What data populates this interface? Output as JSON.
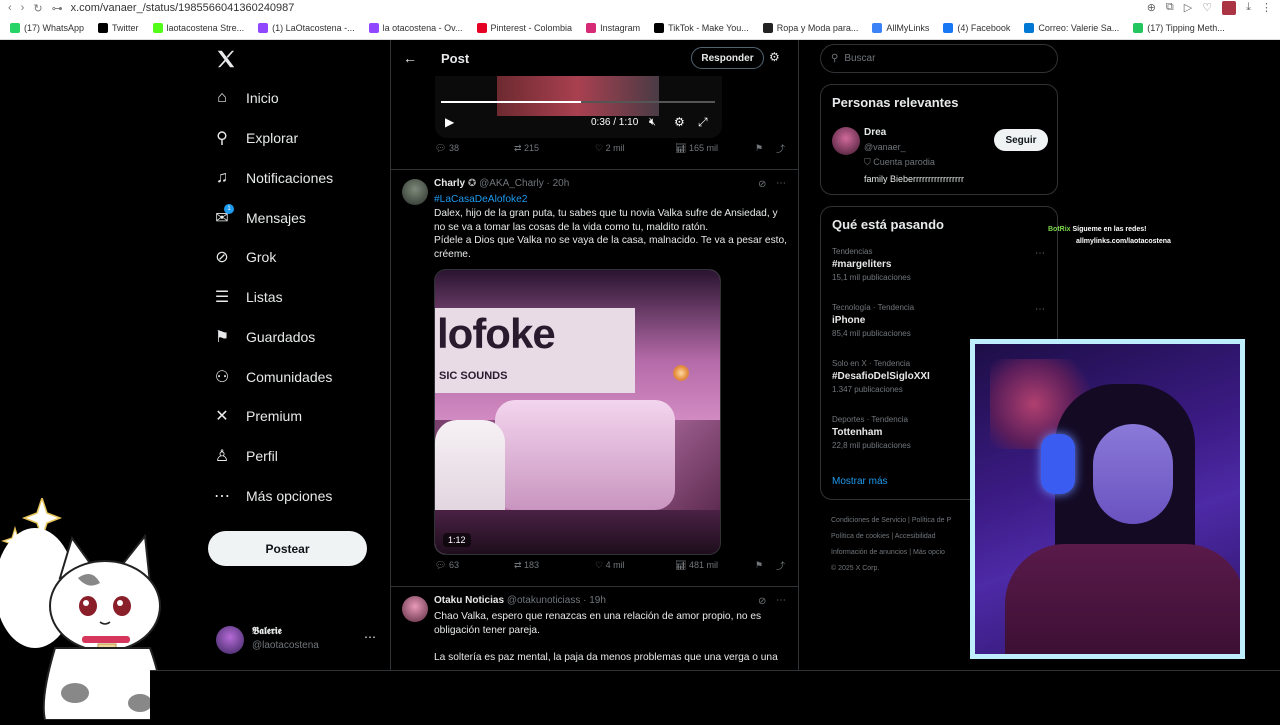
{
  "browser": {
    "url": "x.com/vanaer_/status/1985566041360240987",
    "bookmarks": [
      {
        "label": "(17) WhatsApp",
        "color": "#25d366"
      },
      {
        "label": "Twitter",
        "color": "#000000"
      },
      {
        "label": "laotacostena Stre...",
        "color": "#53fc18"
      },
      {
        "label": "(1) LaOtacostena -...",
        "color": "#9146ff"
      },
      {
        "label": "la otacostena - Ov...",
        "color": "#9146ff"
      },
      {
        "label": "Pinterest - Colombia",
        "color": "#e60023"
      },
      {
        "label": "Instagram",
        "color": "#d62976"
      },
      {
        "label": "TikTok - Make You...",
        "color": "#000000"
      },
      {
        "label": "Ropa y Moda para...",
        "color": "#222222"
      },
      {
        "label": "AllMyLinks",
        "color": "#3b82f6"
      },
      {
        "label": "(4) Facebook",
        "color": "#1877f2"
      },
      {
        "label": "Correo: Valerie Sa...",
        "color": "#0078d4"
      },
      {
        "label": "(17) Tipping Meth...",
        "color": "#22c55e"
      }
    ]
  },
  "sidebar": {
    "logo": "X",
    "items": [
      {
        "label": "Inicio",
        "icon": "home-icon",
        "glyph": "⌂"
      },
      {
        "label": "Explorar",
        "icon": "search-icon",
        "glyph": "⚲"
      },
      {
        "label": "Notificaciones",
        "icon": "bell-icon",
        "glyph": "♫"
      },
      {
        "label": "Mensajes",
        "icon": "mail-icon",
        "glyph": "✉"
      },
      {
        "label": "Grok",
        "icon": "grok-icon",
        "glyph": "⊘"
      },
      {
        "label": "Listas",
        "icon": "list-icon",
        "glyph": "☰"
      },
      {
        "label": "Guardados",
        "icon": "bookmark-icon",
        "glyph": "⚑"
      },
      {
        "label": "Comunidades",
        "icon": "people-icon",
        "glyph": "⚇"
      },
      {
        "label": "Premium",
        "icon": "x-premium-icon",
        "glyph": "✕"
      },
      {
        "label": "Perfil",
        "icon": "person-icon",
        "glyph": "♙"
      },
      {
        "label": "Más opciones",
        "icon": "more-circle-icon",
        "glyph": "⋯"
      }
    ],
    "messages_badge": "1",
    "post_button": "Postear",
    "account": {
      "name": "𝕭𝖆𝖑𝖊𝖗𝖎𝖊",
      "handle": "@laotacostena"
    }
  },
  "header": {
    "title": "Post",
    "reply_button": "Responder"
  },
  "video_top": {
    "time": "0:36 / 1:10",
    "progress": 0.51
  },
  "top_stats": {
    "replies": "38",
    "reposts": "215",
    "likes": "2 mil",
    "views": "165 mil"
  },
  "tweet1": {
    "name": "Charly",
    "handle": "@AKA_Charly · 20h",
    "hashtag": "#LaCasaDeAlofoke2",
    "line1": "Dalex, hijo de la gran puta, tu sabes que tu novia Valka sufre de Ansiedad, y no se va a tomar las cosas de la vida como tu, maldito ratón.",
    "line2": "Pídele a Dios que Valka no se vaya de la casa, malnacido. Te va a pesar esto, créeme.",
    "media_text": "lofoke",
    "media_sub": "SIC SOUNDS",
    "duration": "1:12",
    "stats": {
      "replies": "63",
      "reposts": "183",
      "likes": "4 mil",
      "views": "481 mil"
    }
  },
  "tweet2": {
    "name": "Otaku Noticias",
    "handle": "@otakunoticiass · 19h",
    "line1": "Chao Valka, espero que renazcas en una relación de amor propio, no es obligación tener pareja.",
    "line2": "La soltería es paz mental, la paja da menos problemas que una verga o una"
  },
  "search": {
    "placeholder": "Buscar"
  },
  "relevant": {
    "title": "Personas relevantes",
    "name": "Drea",
    "handle": "@vanaer_",
    "badge": "Cuenta parodia",
    "bio": "family Bieberrrrrrrrrrrrrrrrr",
    "follow": "Seguir"
  },
  "trends": {
    "title": "Qué está pasando",
    "items": [
      {
        "meta": "Tendencias",
        "name": "#margeliters",
        "count": "15,1 mil publicaciones"
      },
      {
        "meta": "Tecnología · Tendencia",
        "name": "iPhone",
        "count": "85,4 mil publicaciones"
      },
      {
        "meta": "Solo en X · Tendencia",
        "name": "#DesafioDelSigloXXI",
        "count": "1.347 publicaciones"
      },
      {
        "meta": "Deportes · Tendencia",
        "name": "Tottenham",
        "count": "22,8 mil publicaciones"
      }
    ],
    "more": "Mostrar más"
  },
  "footer": {
    "links": [
      "Condiciones de Servicio",
      "Política de P",
      "Política de cookies",
      "Accesibilidad",
      "Información de anuncios",
      "Más opcio"
    ],
    "copyright": "© 2025 X Corp."
  },
  "overlay": {
    "bot_name": "BotRix",
    "bot_line1": "Sígueme en las redes!",
    "bot_line2": "allmylinks.com/laotacostena"
  }
}
